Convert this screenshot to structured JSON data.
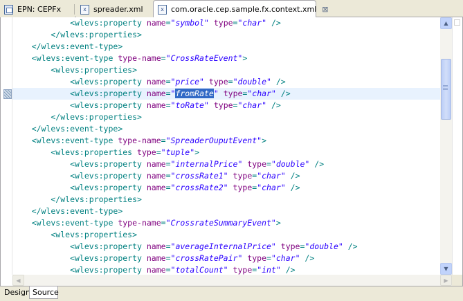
{
  "tabs": [
    {
      "label": "EPN: CEPFx",
      "icon": "epn-diagram-icon",
      "active": false
    },
    {
      "label": "spreader.xml",
      "icon": "xml-file-icon",
      "active": false
    },
    {
      "label": "com.oracle.cep.sample.fx.context.xml",
      "icon": "xml-file-icon",
      "active": true,
      "close": "⊠"
    }
  ],
  "file_icon_glyph": "x",
  "bottom_tabs": [
    {
      "label": "Design",
      "active": false
    },
    {
      "label": "Source",
      "active": true
    }
  ],
  "code_lines": [
    [
      [
        "t",
        "            <wlevs:property "
      ],
      [
        "a",
        "name"
      ],
      [
        "t",
        "="
      ],
      [
        "v",
        "\"symbol\""
      ],
      [
        "t",
        " "
      ],
      [
        "a",
        "type"
      ],
      [
        "t",
        "="
      ],
      [
        "v",
        "\"char\""
      ],
      [
        "t",
        " />"
      ]
    ],
    [
      [
        "t",
        "        </wlevs:properties>"
      ]
    ],
    [
      [
        "t",
        "    </wlevs:event-type>"
      ]
    ],
    [
      [
        "t",
        "    <wlevs:event-type "
      ],
      [
        "a",
        "type-name"
      ],
      [
        "t",
        "="
      ],
      [
        "v",
        "\"CrossRateEvent\""
      ],
      [
        "t",
        ">"
      ]
    ],
    [
      [
        "t",
        "        <wlevs:properties>"
      ]
    ],
    [
      [
        "t",
        "            <wlevs:property "
      ],
      [
        "a",
        "name"
      ],
      [
        "t",
        "="
      ],
      [
        "v",
        "\"price\""
      ],
      [
        "t",
        " "
      ],
      [
        "a",
        "type"
      ],
      [
        "t",
        "="
      ],
      [
        "v",
        "\"double\""
      ],
      [
        "t",
        " />"
      ]
    ],
    [
      [
        "t",
        "            <wlevs:property "
      ],
      [
        "a",
        "name"
      ],
      [
        "t",
        "="
      ],
      [
        "v",
        "\""
      ],
      [
        "s",
        "fromRate"
      ],
      [
        "v",
        "\""
      ],
      [
        "t",
        " "
      ],
      [
        "a",
        "type"
      ],
      [
        "t",
        "="
      ],
      [
        "v",
        "\"char\""
      ],
      [
        "t",
        " />"
      ]
    ],
    [
      [
        "t",
        "            <wlevs:property "
      ],
      [
        "a",
        "name"
      ],
      [
        "t",
        "="
      ],
      [
        "v",
        "\"toRate\""
      ],
      [
        "t",
        " "
      ],
      [
        "a",
        "type"
      ],
      [
        "t",
        "="
      ],
      [
        "v",
        "\"char\""
      ],
      [
        "t",
        " />"
      ]
    ],
    [
      [
        "t",
        "        </wlevs:properties>"
      ]
    ],
    [
      [
        "t",
        "    </wlevs:event-type>"
      ]
    ],
    [
      [
        "t",
        "    <wlevs:event-type "
      ],
      [
        "a",
        "type-name"
      ],
      [
        "t",
        "="
      ],
      [
        "v",
        "\"SpreaderOuputEvent\""
      ],
      [
        "t",
        ">"
      ]
    ],
    [
      [
        "t",
        "        <wlevs:properties "
      ],
      [
        "a",
        "type"
      ],
      [
        "t",
        "="
      ],
      [
        "v",
        "\"tuple\""
      ],
      [
        "t",
        ">"
      ]
    ],
    [
      [
        "t",
        "            <wlevs:property "
      ],
      [
        "a",
        "name"
      ],
      [
        "t",
        "="
      ],
      [
        "v",
        "\"internalPrice\""
      ],
      [
        "t",
        " "
      ],
      [
        "a",
        "type"
      ],
      [
        "t",
        "="
      ],
      [
        "v",
        "\"double\""
      ],
      [
        "t",
        " />"
      ]
    ],
    [
      [
        "t",
        "            <wlevs:property "
      ],
      [
        "a",
        "name"
      ],
      [
        "t",
        "="
      ],
      [
        "v",
        "\"crossRate1\""
      ],
      [
        "t",
        " "
      ],
      [
        "a",
        "type"
      ],
      [
        "t",
        "="
      ],
      [
        "v",
        "\"char\""
      ],
      [
        "t",
        " />"
      ]
    ],
    [
      [
        "t",
        "            <wlevs:property "
      ],
      [
        "a",
        "name"
      ],
      [
        "t",
        "="
      ],
      [
        "v",
        "\"crossRate2\""
      ],
      [
        "t",
        " "
      ],
      [
        "a",
        "type"
      ],
      [
        "t",
        "="
      ],
      [
        "v",
        "\"char\""
      ],
      [
        "t",
        " />"
      ]
    ],
    [
      [
        "t",
        "        </wlevs:properties>"
      ]
    ],
    [
      [
        "t",
        "    </wlevs:event-type>"
      ]
    ],
    [
      [
        "t",
        "    <wlevs:event-type "
      ],
      [
        "a",
        "type-name"
      ],
      [
        "t",
        "="
      ],
      [
        "v",
        "\"CrossrateSummaryEvent\""
      ],
      [
        "t",
        ">"
      ]
    ],
    [
      [
        "t",
        "        <wlevs:properties>"
      ]
    ],
    [
      [
        "t",
        "            <wlevs:property "
      ],
      [
        "a",
        "name"
      ],
      [
        "t",
        "="
      ],
      [
        "v",
        "\"averageInternalPrice\""
      ],
      [
        "t",
        " "
      ],
      [
        "a",
        "type"
      ],
      [
        "t",
        "="
      ],
      [
        "v",
        "\"double\""
      ],
      [
        "t",
        " />"
      ]
    ],
    [
      [
        "t",
        "            <wlevs:property "
      ],
      [
        "a",
        "name"
      ],
      [
        "t",
        "="
      ],
      [
        "v",
        "\"crossRatePair\""
      ],
      [
        "t",
        " "
      ],
      [
        "a",
        "type"
      ],
      [
        "t",
        "="
      ],
      [
        "v",
        "\"char\""
      ],
      [
        "t",
        " />"
      ]
    ],
    [
      [
        "t",
        "            <wlevs:property "
      ],
      [
        "a",
        "name"
      ],
      [
        "t",
        "="
      ],
      [
        "v",
        "\"totalCount\""
      ],
      [
        "t",
        " "
      ],
      [
        "a",
        "type"
      ],
      [
        "t",
        "="
      ],
      [
        "v",
        "\"int\""
      ],
      [
        "t",
        " />"
      ]
    ]
  ],
  "current_line": 7,
  "colors": {
    "tag": "#008080",
    "attribute": "#7f007f",
    "value": "#2a00ff",
    "selection": "#3169c6",
    "current_line": "#e8f2fe"
  },
  "scroll_arrows": {
    "up": "▲",
    "down": "▼",
    "left": "◀",
    "right": "▶"
  }
}
